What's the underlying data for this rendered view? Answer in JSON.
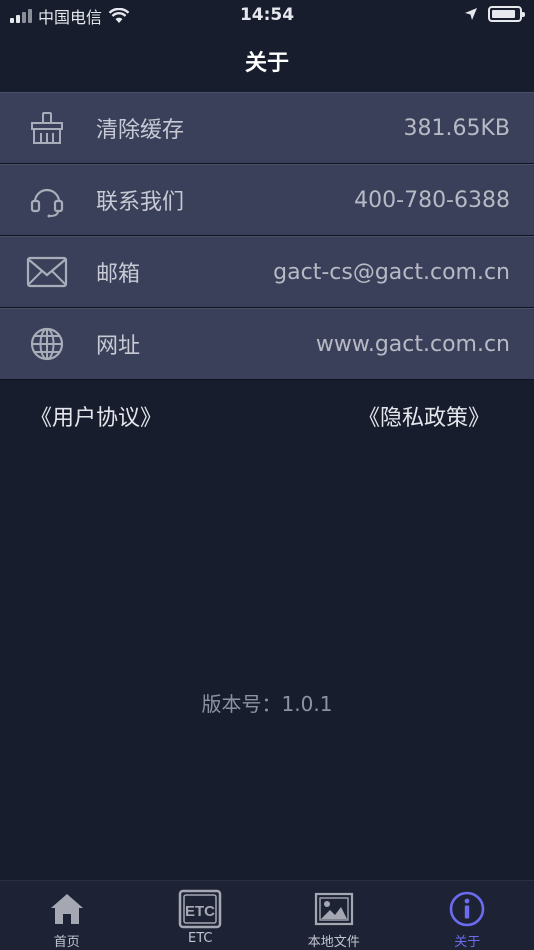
{
  "status_bar": {
    "carrier": "中国电信",
    "time": "14:54",
    "battery_level": 0.9
  },
  "nav": {
    "title": "关于"
  },
  "rows": [
    {
      "icon": "basket-icon",
      "label": "清除缓存",
      "value": "381.65KB"
    },
    {
      "icon": "headset-icon",
      "label": "联系我们",
      "value": "400-780-6388"
    },
    {
      "icon": "mail-icon",
      "label": "邮箱",
      "value": "gact-cs@gact.com.cn"
    },
    {
      "icon": "globe-icon",
      "label": "网址",
      "value": "www.gact.com.cn"
    }
  ],
  "links": {
    "user_agreement": "《用户协议》",
    "privacy_policy": "《隐私政策》"
  },
  "version": "版本号：1.0.1",
  "tabs": [
    {
      "icon": "home-icon",
      "label": "首页",
      "active": false
    },
    {
      "icon": "etc-icon",
      "label": "ETC",
      "active": false
    },
    {
      "icon": "image-icon",
      "label": "本地文件",
      "active": false
    },
    {
      "icon": "info-icon",
      "label": "关于",
      "active": true
    }
  ],
  "colors": {
    "background": "#171d2d",
    "row_background": "#3a4059",
    "active_tab": "#6c6cf0"
  }
}
